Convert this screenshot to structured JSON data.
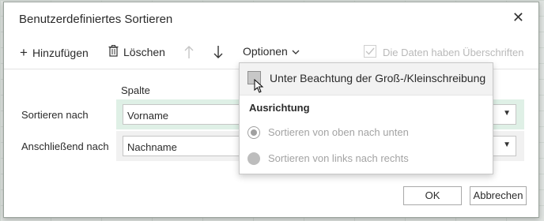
{
  "dialog": {
    "title": "Benutzerdefiniertes Sortieren"
  },
  "toolbar": {
    "add_label": "Hinzufügen",
    "delete_label": "Löschen",
    "options_label": "Optionen",
    "headers_label": "Die Daten haben Überschriften"
  },
  "table": {
    "column_header": "Spalte",
    "rows": [
      {
        "label": "Sortieren nach",
        "value": "Vorname"
      },
      {
        "label": "Anschließend nach",
        "value": "Nachname"
      }
    ]
  },
  "options_menu": {
    "case_label": "Unter Beachtung der Groß-/Kleinschreibung",
    "group_label": "Ausrichtung",
    "radio_top_bottom": "Sortieren von oben nach unten",
    "radio_left_right": "Sortieren von links nach rechts"
  },
  "footer": {
    "ok_label": "OK",
    "cancel_label": "Abbrechen"
  },
  "colors": {
    "accent_selected_row": "#dff0e6"
  }
}
